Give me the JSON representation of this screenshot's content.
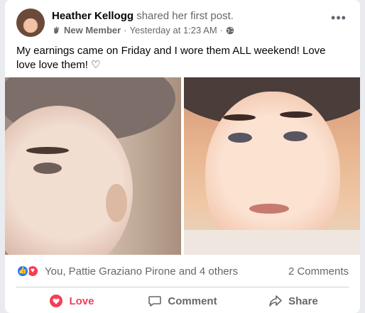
{
  "post": {
    "author_name": "Heather Kellogg",
    "action_text": "shared her first post.",
    "badge_icon": "wave-hand-icon",
    "badge_label": "New Member",
    "separator": "·",
    "timestamp": "Yesterday at 1:23 AM",
    "separator2": "·",
    "privacy_icon": "globe-icon",
    "more_label": "•••",
    "text": "My earnings came on Friday and I wore them ALL weekend! Love love love them! ♡"
  },
  "reactions": {
    "like_glyph": "👍",
    "love_glyph": "♥",
    "names": "You, Pattie Graziano Pirone and 4 others",
    "comments": "2 Comments"
  },
  "actions": {
    "love_label": "Love",
    "comment_label": "Comment",
    "share_label": "Share"
  },
  "colors": {
    "like_blue": "#2078f4",
    "love_red": "#f33e58",
    "secondary_text": "#65676b"
  }
}
